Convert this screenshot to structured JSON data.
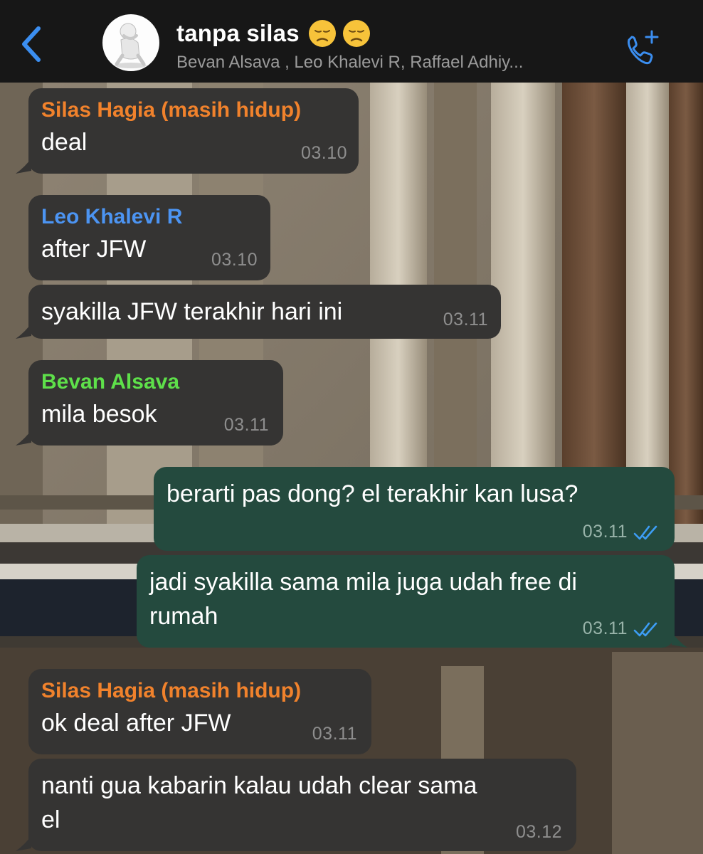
{
  "header": {
    "title": "tanpa silas",
    "title_emojis": [
      "disappointed-face",
      "disappointed-face"
    ],
    "participants": "Bevan Alsava , Leo Khalevi R, Raffael Adhiy...",
    "back_icon": "chevron-left-icon",
    "call_icon": "add-call-icon",
    "accent_color": "#3b8ef0"
  },
  "colors": {
    "silas": "#f1822c",
    "leo": "#4c94f2",
    "bevan": "#5ee04a",
    "incoming_bubble": "#353433",
    "outgoing_bubble": "#244a3e",
    "read_ticks": "#3d9df5"
  },
  "messages": [
    {
      "sender": "Silas Hagia (masih hidup)",
      "text": "deal",
      "time": "03.10"
    },
    {
      "sender": "Leo Khalevi R",
      "text": "after JFW",
      "time": "03.10"
    },
    {
      "text": "syakilla JFW terakhir hari ini",
      "time": "03.11"
    },
    {
      "sender": "Bevan Alsava",
      "text": "mila besok",
      "time": "03.11"
    },
    {
      "text": "berarti pas dong? el terakhir kan lusa?",
      "time": "03.11",
      "status": "read"
    },
    {
      "text_line1": "jadi syakilla sama mila juga udah free di",
      "text_line2": "rumah",
      "time": "03.11",
      "status": "read"
    },
    {
      "sender": "Silas Hagia (masih hidup)",
      "text": "ok deal after JFW",
      "time": "03.11"
    },
    {
      "text_line1": "nanti gua kabarin kalau udah clear sama",
      "text_line2": "el",
      "time": "03.12"
    }
  ]
}
